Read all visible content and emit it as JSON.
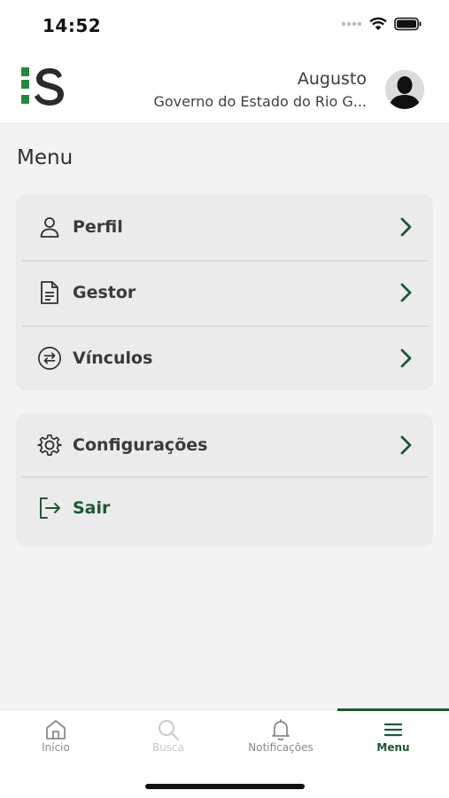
{
  "status": {
    "time": "14:52"
  },
  "header": {
    "user_name": "Augusto",
    "user_org": "Governo do Estado do Rio G..."
  },
  "page": {
    "title": "Menu"
  },
  "menu_groups": [
    {
      "items": [
        {
          "label": "Perfil",
          "icon": "user-icon"
        },
        {
          "label": "Gestor",
          "icon": "document-icon"
        },
        {
          "label": "Vínculos",
          "icon": "exchange-icon"
        }
      ]
    },
    {
      "items": [
        {
          "label": "Configurações",
          "icon": "gear-icon"
        },
        {
          "label": "Sair",
          "icon": "logout-icon"
        }
      ]
    }
  ],
  "bottom_nav": [
    {
      "label": "Início",
      "icon": "home-icon",
      "state": "normal"
    },
    {
      "label": "Busca",
      "icon": "search-icon",
      "state": "disabled"
    },
    {
      "label": "Notificações",
      "icon": "bell-icon",
      "state": "normal"
    },
    {
      "label": "Menu",
      "icon": "menu-icon",
      "state": "active"
    }
  ],
  "colors": {
    "brand_green": "#1a5a34",
    "logo_green": "#1f8a3c",
    "card_bg": "#ebebeb",
    "page_bg": "#f3f3f3"
  }
}
